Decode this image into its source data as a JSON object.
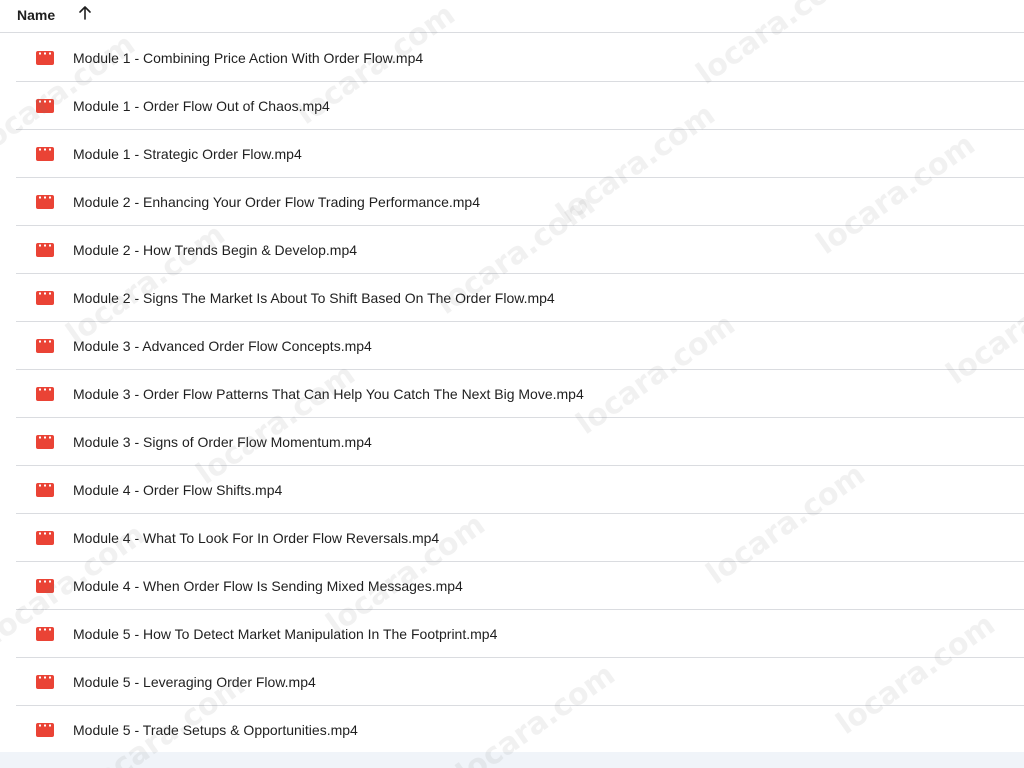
{
  "header": {
    "name_label": "Name",
    "sort_icon": "arrow-up-icon"
  },
  "colors": {
    "video_icon": "#ea4335",
    "divider": "#dadce0",
    "text": "#1f1f1f"
  },
  "file_icon": "video-file-icon",
  "files": [
    {
      "name": "Module 1 - Combining Price Action With Order Flow.mp4"
    },
    {
      "name": "Module 1 - Order Flow Out of Chaos.mp4"
    },
    {
      "name": "Module 1 - Strategic Order Flow.mp4"
    },
    {
      "name": "Module 2 - Enhancing Your Order Flow Trading Performance.mp4"
    },
    {
      "name": "Module 2 - How Trends Begin & Develop.mp4"
    },
    {
      "name": "Module 2 - Signs The Market Is About To Shift Based On The Order Flow.mp4"
    },
    {
      "name": "Module 3 - Advanced Order Flow Concepts.mp4"
    },
    {
      "name": "Module 3 - Order Flow Patterns That Can Help You Catch The Next Big Move.mp4"
    },
    {
      "name": "Module 3 - Signs of Order Flow Momentum.mp4"
    },
    {
      "name": "Module 4 - Order Flow Shifts.mp4"
    },
    {
      "name": "Module 4 - What To Look For In Order Flow Reversals.mp4"
    },
    {
      "name": "Module 4 - When Order Flow Is Sending Mixed Messages.mp4"
    },
    {
      "name": "Module 5 - How To Detect Market Manipulation In The Footprint.mp4"
    },
    {
      "name": "Module 5 - Leveraging Order Flow.mp4"
    },
    {
      "name": "Module 5 - Trade Setups & Opportunities.mp4"
    }
  ],
  "watermark": {
    "text": "locara.com"
  }
}
